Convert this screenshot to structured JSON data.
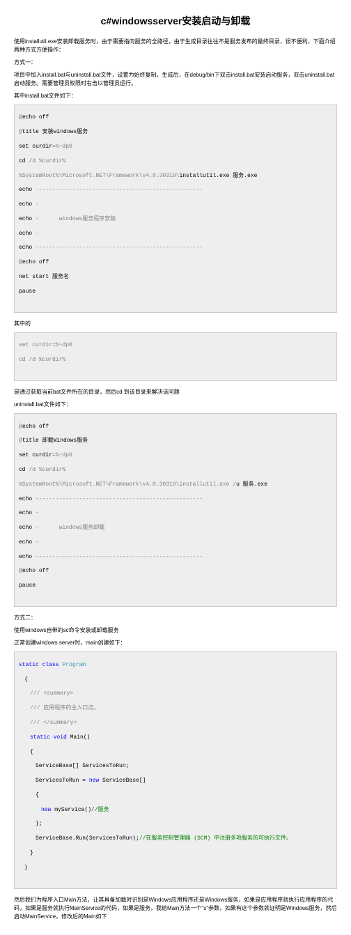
{
  "title": "c#windowsserver安装启动与卸载",
  "intro": "使用installutil.exe安装卸载服务时，由于需要指向服务的全路径，由于生成目录往往不是服务发布的最终目录，很不便利，下面介绍两种方式方便操作：",
  "method1_label": "方式一：",
  "method1_desc": "项目中加入install.bat与uninstall.bat文件，设置为始终复制，生成后，在debug/bin下双击install.bat安装启动服务，双击uninstall.bat启动服务。需要管理员权限时右击以管理员运行。",
  "install_header": "其中install.bat文件如下：",
  "code1": {
    "l1a": "@",
    "l1b": "echo off",
    "l2a": "@",
    "l2b": "title 安装windows服务",
    "l3a": "set curdir",
    "l3b": "=%~dp0",
    "l4a": "cd",
    "l4b": " /d %curdir%",
    "l5a": "%SystemRoot%\\Microsoft.NET\\Framework\\v4.0.30319\\",
    "l5b": "installutil.exe 服务.exe",
    "l6a": "echo",
    "l6b": " --------------------------------------------------",
    "l7a": "echo",
    "l7b": " -",
    "l8a": "echo",
    "l8b": " -      windows服务程序安装",
    "l9a": "echo",
    "l9b": " -",
    "l10a": "echo",
    "l10b": " --------------------------------------------------",
    "l11a": "@",
    "l11b": "echo off",
    "l12": "net start 服务名",
    "l13": "pause"
  },
  "mid_label": "其中的",
  "mid_code": {
    "l1": "set curdir=%~dp0",
    "l2": "cd /d %curdir%"
  },
  "mid_desc": "是通过获取当前bat文件所在的目录，然后cd 到该目录来解决该问题",
  "uninstall_header": "uninstall.bat文件如下：",
  "code2": {
    "l1a": "@",
    "l1b": "echo off",
    "l2a": "@",
    "l2b": "title 卸载Windows服务",
    "l3a": "set curdir",
    "l3b": "=%~dp0",
    "l4a": "cd",
    "l4b": " /d %curdir%",
    "l5a": "%SystemRoot%\\Microsoft.NET\\Framework\\v4.0.30319\\installutil.exe /",
    "l5b": "u 服务.exe",
    "l6a": "echo",
    "l6b": " --------------------------------------------------",
    "l7a": "echo",
    "l7b": " -",
    "l8a": "echo",
    "l8b": " -      windows服务卸载",
    "l9a": "echo",
    "l9b": " -",
    "l10a": "echo",
    "l10b": " --------------------------------------------------",
    "l11a": "@",
    "l11b": "echo off",
    "l12": "pause"
  },
  "method2_label": "方式二：",
  "method2_desc": "使用windows自带的sc命令安装或卸载服务",
  "normal_desc": "正常创建windows server时，main创建如下：",
  "code3": {
    "static": "static",
    "class": " class",
    "program": " Program",
    "ob": "{",
    "sum1": "/// <summary>",
    "sum2": "/// 应用程序的主入口点。",
    "sum3": "/// </summary>",
    "static2": "static",
    "void": " void",
    "main": " Main()",
    "ob2": "{",
    "line1": "ServiceBase[] ServicesToRun;",
    "line2a": "ServicesToRun = ",
    "line2b": "new",
    "line2c": " ServiceBase[]",
    "ob3": "{",
    "line3a": "new",
    "line3b": " myService()",
    "line3c": "//服务",
    "cb3": "};",
    "line4a": "ServiceBase.Run(ServicesToRun);",
    "line4b": "//在服务控制管理器 (SCM) 中注册多项服务的可执行文件。",
    "cb2": "}",
    "cb1": "}"
  },
  "final1": "然后我们为程序入口Main方法，让其具备加载时识别是Windows应用程序还是Windows服务，如果是应用程序就执行应用程序的代码，如果是服务就执行MainService的代码，如果是服务，我给Main方法一个\"s\"参数，如果有这个参数就证明是Windows服务，然后启动MainService，修改后的Main如下",
  "final2": ""
}
